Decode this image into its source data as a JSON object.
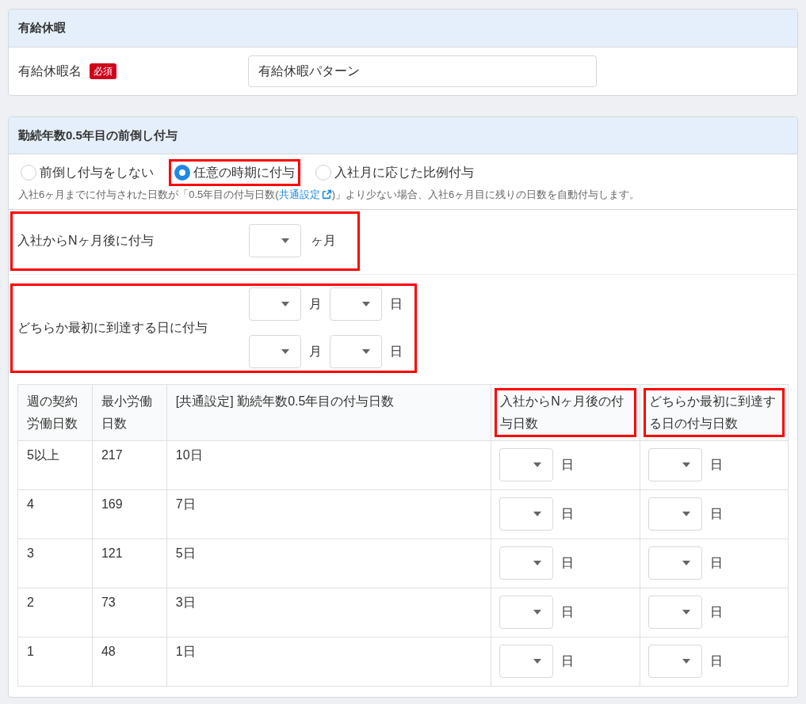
{
  "leave_section": {
    "title": "有給休暇",
    "name_field": {
      "label": "有給休暇名",
      "badge": "必須",
      "value": "有給休暇パターン"
    }
  },
  "advance_section": {
    "title": "勤続年数0.5年目の前倒し付与",
    "options": [
      {
        "label": "前倒し付与をしない",
        "selected": false,
        "highlighted": false
      },
      {
        "label": "任意の時期に付与",
        "selected": true,
        "highlighted": true
      },
      {
        "label": "入社月に応じた比例付与",
        "selected": false,
        "highlighted": false
      }
    ],
    "note": {
      "before": "入社6ヶ月までに付与された日数が「0.5年目の付与日数(",
      "link": "共通設定",
      "after": ")」より少ない場合、入社6ヶ月目に残りの日数を自動付与します。"
    },
    "n_months_row": {
      "label": "入社からNヶ月後に付与",
      "unit": "ヶ月",
      "highlighted": true
    },
    "earliest_row": {
      "label": "どちらか最初に到達する日に付与",
      "highlighted": true,
      "dates": [
        {
          "month_unit": "月",
          "day_unit": "日"
        },
        {
          "month_unit": "月",
          "day_unit": "日"
        }
      ]
    },
    "table": {
      "columns": [
        {
          "label": "週の契約労働日数",
          "highlighted": false
        },
        {
          "label": "最小労働日数",
          "highlighted": false
        },
        {
          "label": "[共通設定] 勤続年数0.5年目の付与日数",
          "highlighted": false
        },
        {
          "label": "入社からNヶ月後の付与日数",
          "highlighted": true
        },
        {
          "label": "どちらか最初に到達する日の付与日数",
          "highlighted": true
        }
      ],
      "rows": [
        {
          "days_per_week": "5以上",
          "min_days": "217",
          "common_days": "10日",
          "n_month_unit": "日",
          "earliest_unit": "日"
        },
        {
          "days_per_week": "4",
          "min_days": "169",
          "common_days": "7日",
          "n_month_unit": "日",
          "earliest_unit": "日"
        },
        {
          "days_per_week": "3",
          "min_days": "121",
          "common_days": "5日",
          "n_month_unit": "日",
          "earliest_unit": "日"
        },
        {
          "days_per_week": "2",
          "min_days": "73",
          "common_days": "3日",
          "n_month_unit": "日",
          "earliest_unit": "日"
        },
        {
          "days_per_week": "1",
          "min_days": "48",
          "common_days": "1日",
          "n_month_unit": "日",
          "earliest_unit": "日"
        }
      ]
    }
  }
}
